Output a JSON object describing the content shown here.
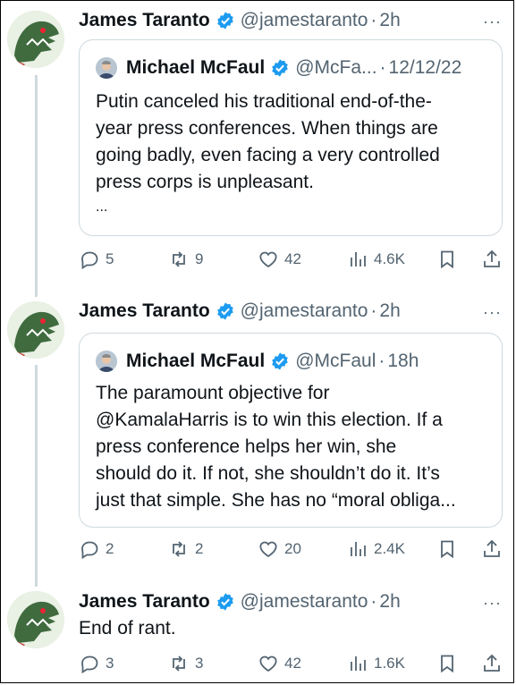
{
  "tweets": [
    {
      "author": {
        "name": "James Taranto",
        "handle": "@jamestaranto",
        "time": "2h",
        "verified_color": "#1d9bf0"
      },
      "quote": {
        "author": {
          "name": "Michael McFaul",
          "handle": "@McFa...",
          "time": "12/12/22"
        },
        "lines": [
          "Putin canceled his traditional end-of-the-",
          "year press conferences. When things are",
          "going badly, even facing a very controlled",
          "press corps is unpleasant."
        ],
        "ellipsis": "..."
      },
      "stats": {
        "replies": "5",
        "reposts": "9",
        "likes": "42",
        "views": "4.6K"
      }
    },
    {
      "author": {
        "name": "James Taranto",
        "handle": "@jamestaranto",
        "time": "2h"
      },
      "quote": {
        "author": {
          "name": "Michael McFaul",
          "handle": "@McFaul",
          "time": "18h"
        },
        "lines": [
          "The paramount objective for",
          "@KamalaHarris is to win this election.  If a",
          "press conference helps her win, she",
          "should do it. If not, she shouldn’t do it. It’s",
          "just that simple. She has no “moral obliga..."
        ]
      },
      "stats": {
        "replies": "2",
        "reposts": "2",
        "likes": "20",
        "views": "2.4K"
      }
    },
    {
      "author": {
        "name": "James Taranto",
        "handle": "@jamestaranto",
        "time": "2h"
      },
      "text": "End of rant.",
      "stats": {
        "replies": "3",
        "reposts": "3",
        "likes": "42",
        "views": "1.6K"
      }
    }
  ],
  "separator": "·",
  "more_icon": "···",
  "icons": [
    "reply-icon",
    "repost-icon",
    "like-icon",
    "views-icon",
    "bookmark-icon",
    "share-icon",
    "verified-badge-icon"
  ]
}
